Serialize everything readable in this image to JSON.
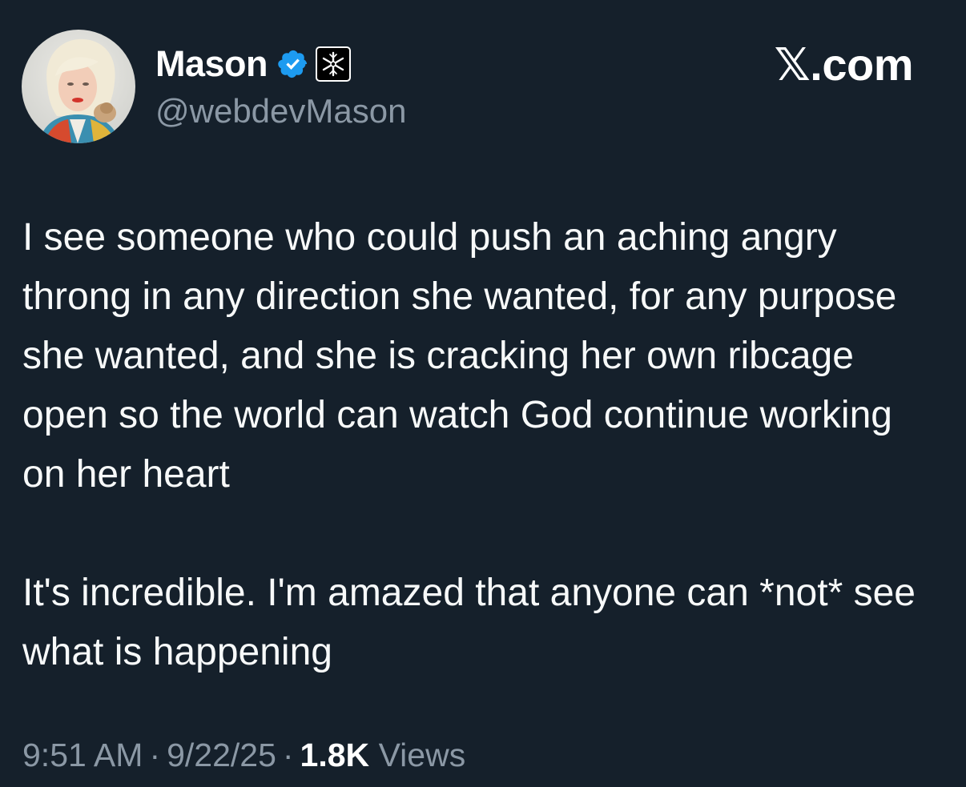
{
  "author": {
    "display_name": "Mason",
    "handle": "@webdevMason"
  },
  "brand": "𝕏.com",
  "tweet": {
    "paragraphs": [
      "I see someone who could push an aching angry throng in any direction she wanted, for any purpose she wanted, and she is cracking her own ribcage open so the world can watch God continue working on her heart",
      "It's incredible. I'm amazed that anyone can *not* see what is happening"
    ]
  },
  "meta": {
    "time": "9:51 AM",
    "separator": "·",
    "date": "9/22/25",
    "views_count": "1.8K",
    "views_label": "Views"
  },
  "icons": {
    "verified": "verified-badge-icon",
    "affiliation": "affiliation-badge-icon"
  },
  "colors": {
    "background": "#15202b",
    "text": "#f7f9f9",
    "secondary": "#8b98a5",
    "verified_blue": "#1d9bf0"
  }
}
